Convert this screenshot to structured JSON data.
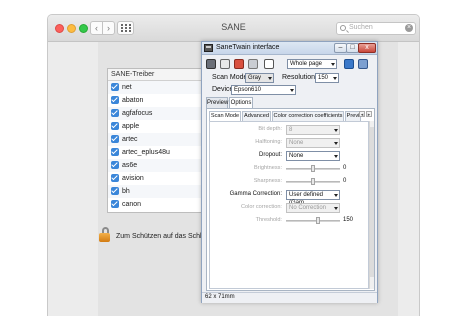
{
  "mac_window": {
    "title": "SANE",
    "search_placeholder": "Suchen",
    "nav_back": "‹",
    "nav_forward": "›",
    "search_clear": "×"
  },
  "driver_list": {
    "header": "SANE-Treiber",
    "items": [
      {
        "name": "net",
        "checked": true
      },
      {
        "name": "abaton",
        "checked": true
      },
      {
        "name": "agfafocus",
        "checked": true
      },
      {
        "name": "apple",
        "checked": true
      },
      {
        "name": "artec",
        "checked": true
      },
      {
        "name": "artec_eplus48u",
        "checked": true
      },
      {
        "name": "as6e",
        "checked": true
      },
      {
        "name": "avision",
        "checked": true
      },
      {
        "name": "bh",
        "checked": true
      },
      {
        "name": "canon",
        "checked": true
      }
    ]
  },
  "lock": {
    "text": "Zum Schützen auf das Schloss"
  },
  "twain": {
    "title": "SaneTwain interface",
    "min_label": "–",
    "max_label": "□",
    "close_label": "x",
    "toolbar": {
      "page_size": "Whole page"
    },
    "scan_mode": {
      "label": "Scan Mode:",
      "value": "Gray"
    },
    "resolution": {
      "label": "Resolution:",
      "value": "150"
    },
    "device": {
      "label": "Device:",
      "value": "Epson610"
    },
    "outer_tabs": [
      "Preview",
      "Options"
    ],
    "active_outer_tab": "Options",
    "inner_tabs": [
      "Scan Mode",
      "Advanced",
      "Color correction coefficients",
      "Previ"
    ],
    "active_inner_tab": "Scan Mode",
    "inner_tab_prev": "◂",
    "inner_tab_next": "▸",
    "fields": [
      {
        "label": "Bit depth:",
        "type": "combo",
        "value": "8",
        "enabled": false
      },
      {
        "label": "Halftoning:",
        "type": "combo",
        "value": "None",
        "enabled": false
      },
      {
        "label": "Dropout:",
        "type": "combo",
        "value": "None",
        "enabled": true
      },
      {
        "label": "Brightness:",
        "type": "slider",
        "value": "0",
        "level": 0.5,
        "enabled": false
      },
      {
        "label": "Sharpness:",
        "type": "slider",
        "value": "0",
        "level": 0.5,
        "enabled": false
      },
      {
        "label": "Gamma Correction:",
        "type": "combo",
        "value": "User defined (Gam",
        "enabled": true
      },
      {
        "label": "Color correction:",
        "type": "combo",
        "value": "No Correction",
        "enabled": false
      },
      {
        "label": "Threshold:",
        "type": "slider",
        "value": "150",
        "level": 0.6,
        "enabled": false
      }
    ],
    "status": "62 x 71mm"
  },
  "colors": {
    "checkbox": "#3a86d9",
    "close_button": "#c9463a",
    "lock": "#e0951f"
  }
}
